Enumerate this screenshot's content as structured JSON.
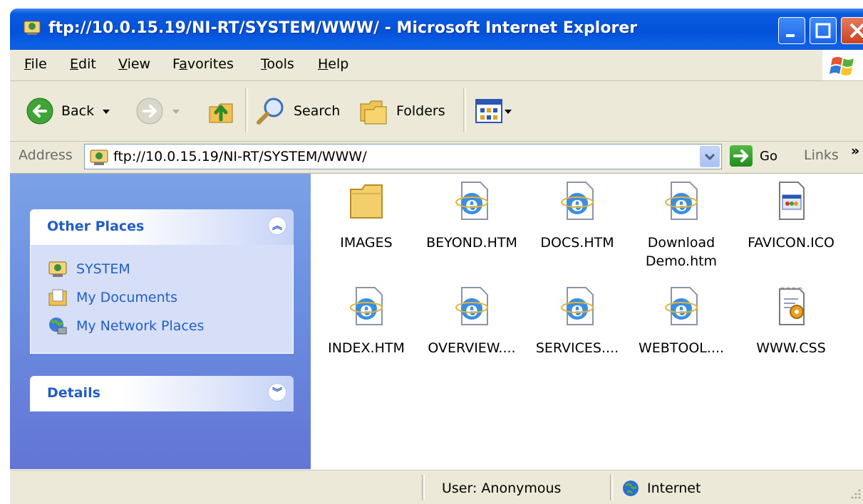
{
  "window": {
    "title": "ftp://10.0.15.19/NI-RT/SYSTEM/WWW/ - Microsoft Internet Explorer"
  },
  "menubar": {
    "items": [
      {
        "label": "File",
        "underline": "F",
        "rest": "ile"
      },
      {
        "label": "Edit",
        "underline": "E",
        "rest": "dit"
      },
      {
        "label": "View",
        "underline": "V",
        "rest": "iew"
      },
      {
        "label": "Favorites",
        "underline": "a",
        "pre": "F",
        "rest": "vorites"
      },
      {
        "label": "Tools",
        "underline": "T",
        "rest": "ools"
      },
      {
        "label": "Help",
        "underline": "H",
        "rest": "elp"
      }
    ]
  },
  "toolbar": {
    "back_label": "Back",
    "search_label": "Search",
    "folders_label": "Folders"
  },
  "address": {
    "label": "Address",
    "value": "ftp://10.0.15.19/NI-RT/SYSTEM/WWW/",
    "go_label": "Go",
    "links_label": "Links",
    "chevron": "»"
  },
  "sidebar": {
    "other_places": {
      "title": "Other Places",
      "items": [
        "SYSTEM",
        "My Documents",
        "My Network Places"
      ]
    },
    "details": {
      "title": "Details"
    }
  },
  "files": [
    {
      "name": "IMAGES",
      "icon": "folder-icon"
    },
    {
      "name": "BEYOND.HTM",
      "icon": "ie-document-icon"
    },
    {
      "name": "DOCS.HTM",
      "icon": "ie-document-icon"
    },
    {
      "name": "Download\nDemo.htm",
      "line1": "Download",
      "line2": "Demo.htm",
      "icon": "ie-document-icon"
    },
    {
      "name": "FAVICON.ICO",
      "icon": "icon-file-icon"
    },
    {
      "name": "INDEX.HTM",
      "icon": "ie-document-icon"
    },
    {
      "name": "OVERVIEW....",
      "icon": "ie-document-icon"
    },
    {
      "name": "SERVICES....",
      "icon": "ie-document-icon"
    },
    {
      "name": "WEBTOOL....",
      "icon": "ie-document-icon"
    },
    {
      "name": "WWW.CSS",
      "icon": "css-file-icon"
    }
  ],
  "statusbar": {
    "user": "User: Anonymous",
    "zone": "Internet"
  },
  "colors": {
    "titlebar": "#0451d8",
    "sidebar": "#6b8ee0",
    "panel_title": "#215dc6",
    "chrome": "#ece9d8"
  }
}
